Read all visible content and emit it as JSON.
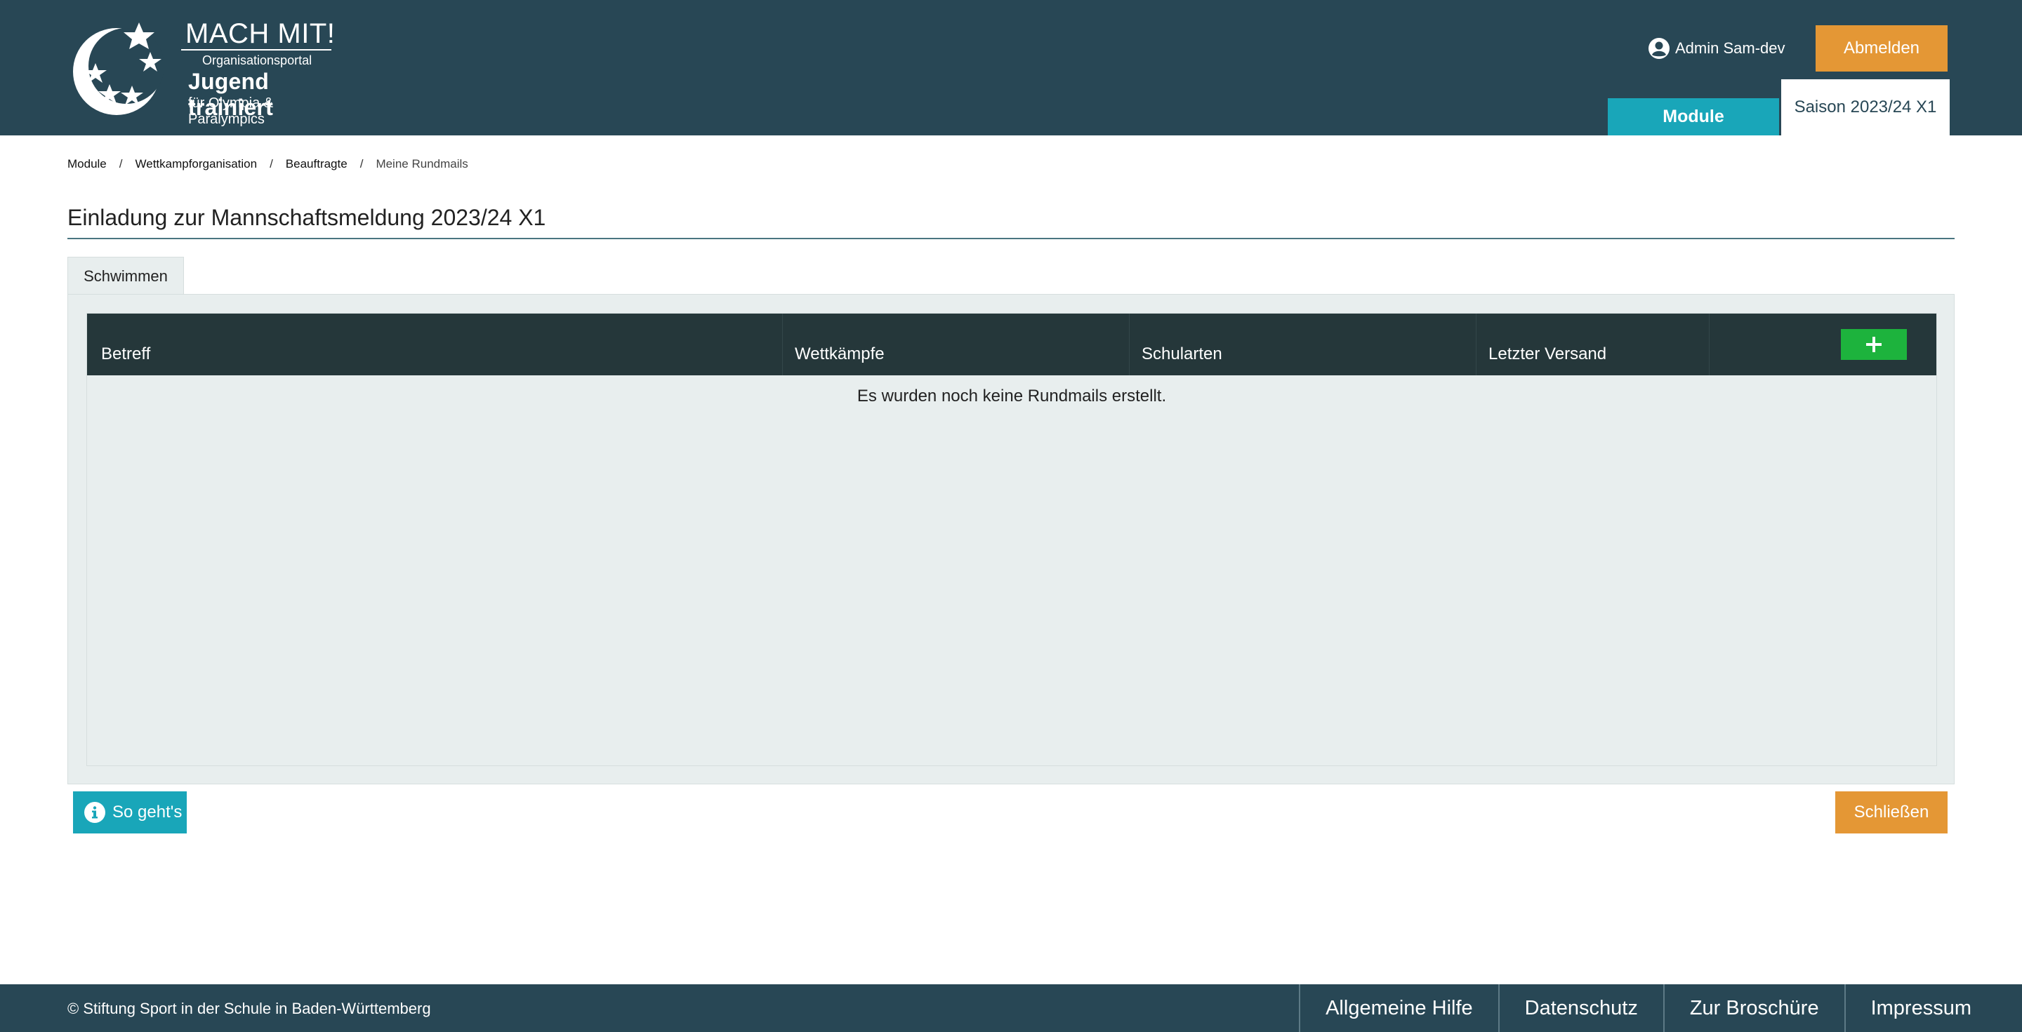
{
  "header": {
    "logo": {
      "title": "MACH MIT!",
      "subtitle": "Organisationsportal",
      "brand": "Jugend trainiert",
      "tagline": "für Olympia & Paralympics"
    },
    "user_label": "Admin Sam-dev",
    "logout_label": "Abmelden",
    "tabs": [
      {
        "label": "Module"
      },
      {
        "label": "Saison 2023/24 X1"
      }
    ]
  },
  "breadcrumb": {
    "items": [
      "Module",
      "Wettkampforganisation",
      "Beauftragte",
      "Meine Rundmails"
    ],
    "separator": "/"
  },
  "page": {
    "title": "Einladung zur Mannschaftsmeldung 2023/24 X1",
    "tab": "Schwimmen"
  },
  "table": {
    "columns": [
      "Betreff",
      "Wettkämpfe",
      "Schularten",
      "Letzter Versand"
    ],
    "add_label": "+",
    "empty_message": "Es wurden noch keine Rundmails erstellt."
  },
  "actions": {
    "help_label": "So geht's",
    "close_label": "Schließen"
  },
  "footer": {
    "copyright": "© Stiftung Sport in der Schule in Baden-Württemberg",
    "links": [
      "Allgemeine Hilfe",
      "Datenschutz",
      "Zur Broschüre",
      "Impressum"
    ]
  },
  "colors": {
    "header_bg": "#284755",
    "accent_orange": "#e49735",
    "accent_teal": "#19a6b9",
    "table_header": "#25373a",
    "add_green": "#1db33d",
    "panel_bg": "#e8eeee"
  }
}
